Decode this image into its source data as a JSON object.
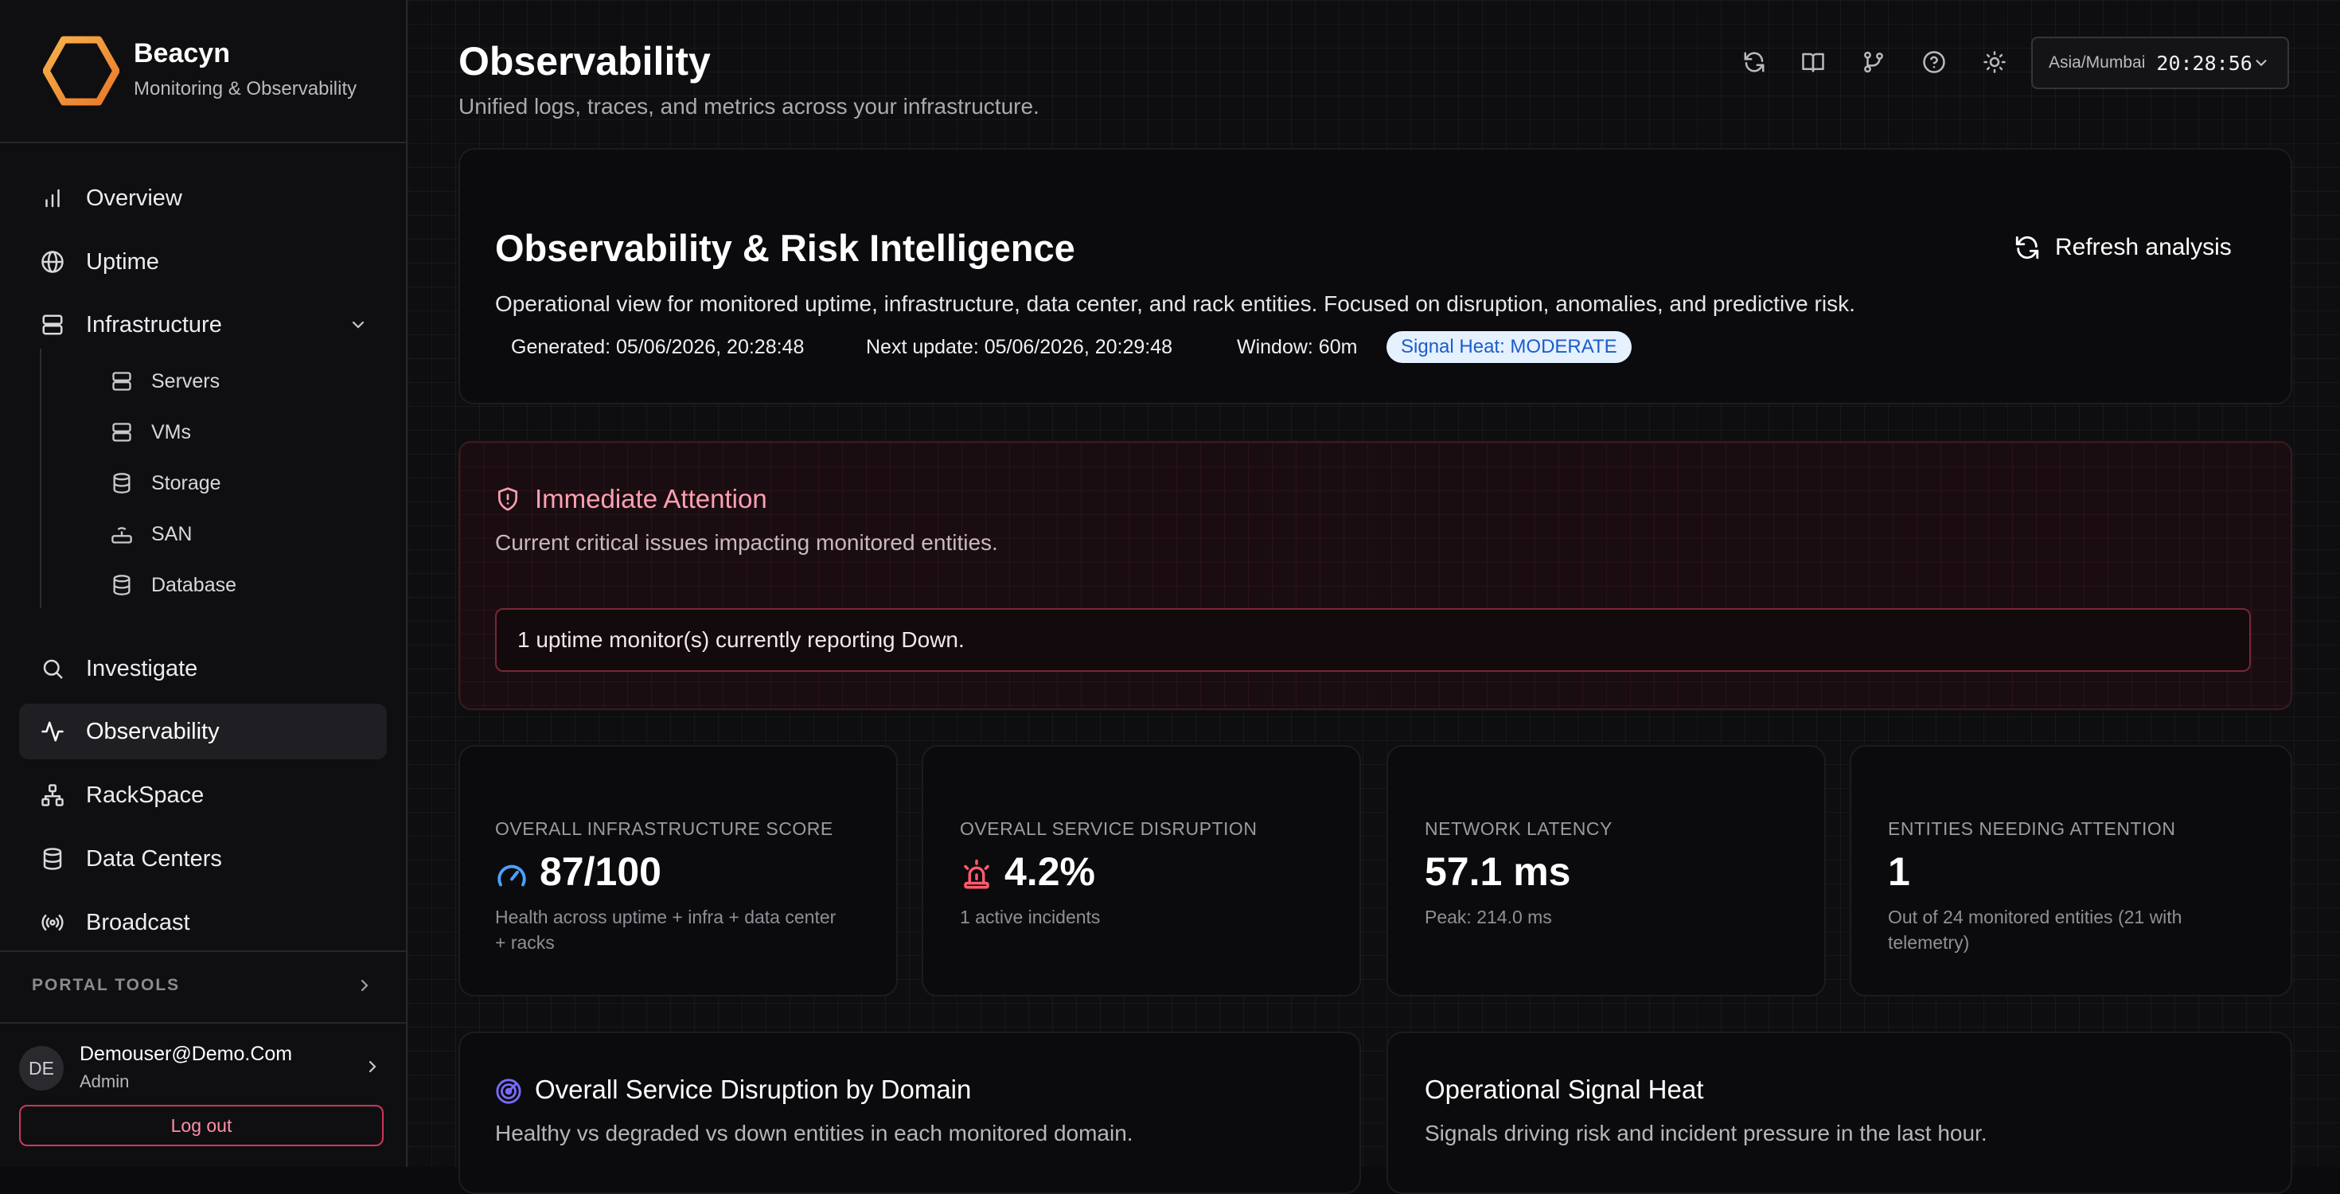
{
  "brand": {
    "name": "Beacyn",
    "subtitle": "Monitoring & Observability"
  },
  "nav": {
    "overview": "Overview",
    "uptime": "Uptime",
    "infrastructure": "Infrastructure",
    "servers": "Servers",
    "vms": "VMs",
    "storage": "Storage",
    "san": "SAN",
    "database": "Database",
    "investigate": "Investigate",
    "observability": "Observability",
    "rackspace": "RackSpace",
    "datacenters": "Data Centers",
    "broadcast": "Broadcast"
  },
  "portal": {
    "label": "PORTAL TOOLS"
  },
  "user": {
    "initials": "DE",
    "email": "Demouser@Demo.Com",
    "role": "Admin",
    "logout": "Log out"
  },
  "header": {
    "title": "Observability",
    "subtitle": "Unified logs, traces, and metrics across your infrastructure.",
    "timezone": "Asia/Mumbai",
    "time": "20:28:56",
    "icons": [
      "refresh-icon",
      "book-icon",
      "git-branch-icon",
      "help-icon",
      "sun-icon"
    ]
  },
  "risk": {
    "title": "Observability & Risk Intelligence",
    "description": "Operational view for monitored uptime, infrastructure, data center, and rack entities. Focused on disruption, anomalies, and predictive risk.",
    "generated": "Generated: 05/06/2026, 20:28:48",
    "next_update": "Next update: 05/06/2026, 20:29:48",
    "window": "Window: 60m",
    "heat": "Signal Heat: MODERATE",
    "refresh": "Refresh analysis"
  },
  "alert": {
    "title": "Immediate Attention",
    "subtitle": "Current critical issues impacting monitored entities.",
    "message": "1 uptime monitor(s) currently reporting Down."
  },
  "kpis": [
    {
      "label": "OVERALL INFRASTRUCTURE SCORE",
      "value": "87/100",
      "note": "Health across uptime + infra + data center + racks"
    },
    {
      "label": "OVERALL SERVICE DISRUPTION",
      "value": "4.2%",
      "note": "1 active incidents"
    },
    {
      "label": "NETWORK LATENCY",
      "value": "57.1 ms",
      "note": "Peak: 214.0 ms"
    },
    {
      "label": "ENTITIES NEEDING ATTENTION",
      "value": "1",
      "note": "Out of 24 monitored entities (21 with telemetry)"
    }
  ],
  "sections": {
    "disruption": {
      "title": "Overall Service Disruption by Domain",
      "subtitle": "Healthy vs degraded vs down entities in each monitored domain."
    },
    "heat": {
      "title": "Operational Signal Heat",
      "subtitle": "Signals driving risk and incident pressure in the last hour."
    }
  },
  "colors": {
    "accent_orange": "#f2993a",
    "alert_pink": "#ff9fb2",
    "score_blue": "#4aa3ff",
    "disruption_red": "#ff5a6e",
    "heat_badge_bg": "#e6f1ff"
  }
}
